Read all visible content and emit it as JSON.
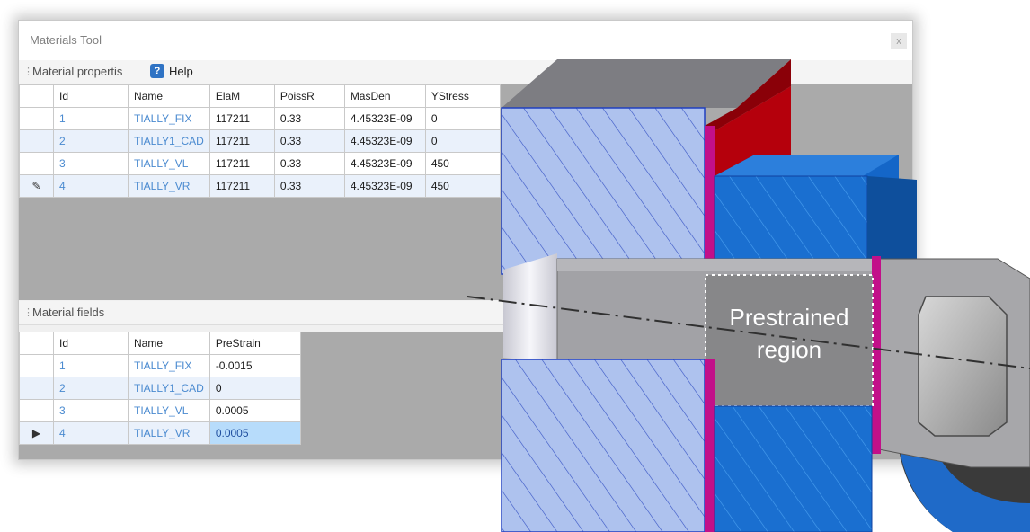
{
  "window": {
    "title": "Materials Tool",
    "close_label": "x"
  },
  "properties_toolbar": {
    "label": "Material propertis",
    "help_label": "Help"
  },
  "properties_table": {
    "columns": [
      "Id",
      "Name",
      "ElaM",
      "PoissR",
      "MasDen",
      "YStress"
    ],
    "rows": [
      {
        "marker": "",
        "id": "1",
        "name": "TIALLY_FIX",
        "elam": "117211",
        "poissr": "0.33",
        "masden": "4.45323E-09",
        "ystress": "0"
      },
      {
        "marker": "",
        "id": "2",
        "name": "TIALLY1_CAD",
        "elam": "117211",
        "poissr": "0.33",
        "masden": "4.45323E-09",
        "ystress": "0"
      },
      {
        "marker": "",
        "id": "3",
        "name": "TIALLY_VL",
        "elam": "117211",
        "poissr": "0.33",
        "masden": "4.45323E-09",
        "ystress": "450"
      },
      {
        "marker": "✎",
        "id": "4",
        "name": "TIALLY_VR",
        "elam": "117211",
        "poissr": "0.33",
        "masden": "4.45323E-09",
        "ystress": "450"
      }
    ]
  },
  "fields_toolbar": {
    "label": "Material fields"
  },
  "fields_table": {
    "columns": [
      "Id",
      "Name",
      "PreStrain"
    ],
    "rows": [
      {
        "marker": "",
        "id": "1",
        "name": "TIALLY_FIX",
        "prestrain": "-0.0015"
      },
      {
        "marker": "",
        "id": "2",
        "name": "TIALLY1_CAD",
        "prestrain": "0"
      },
      {
        "marker": "",
        "id": "3",
        "name": "TIALLY_VL",
        "prestrain": "0.0005"
      },
      {
        "marker": "▶",
        "id": "4",
        "name": "TIALLY_VR",
        "prestrain": "0.0005"
      }
    ]
  },
  "illustration": {
    "region_label_line1": "Prestrained",
    "region_label_line2": "region",
    "colors": {
      "hatch_section": "#aac0f0",
      "hatch_line": "#3050c0",
      "blue_part": "#1565c0",
      "red_part": "#b00010",
      "magenta_edge": "#c0108a",
      "grey_part": "#9a9a9a"
    }
  }
}
